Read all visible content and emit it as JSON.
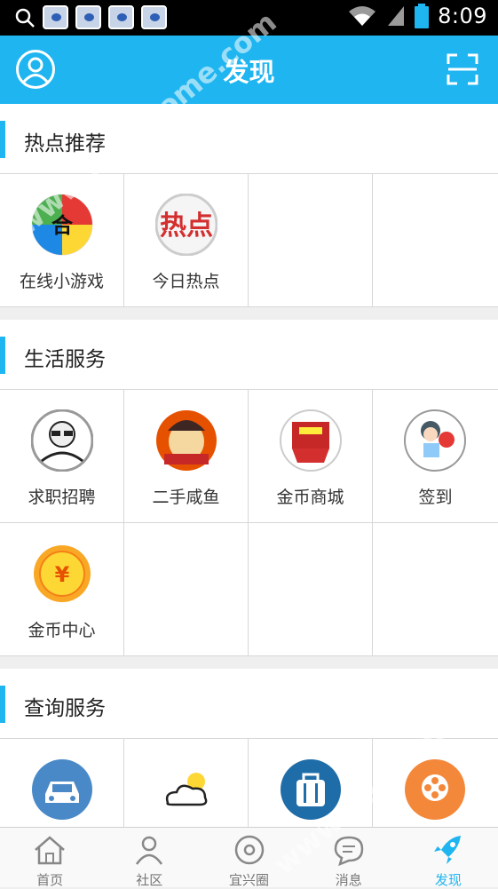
{
  "status_bar": {
    "time": "8:09"
  },
  "header": {
    "title": "发现",
    "profile_icon": "profile-icon",
    "scan_icon": "scan-icon"
  },
  "sections": [
    {
      "title": "热点推荐",
      "items": [
        {
          "label": "在线小游戏",
          "icon": "mini-games-icon"
        },
        {
          "label": "今日热点",
          "icon": "hot-topics-icon"
        }
      ]
    },
    {
      "title": "生活服务",
      "items": [
        {
          "label": "求职招聘",
          "icon": "jobs-icon"
        },
        {
          "label": "二手咸鱼",
          "icon": "second-hand-icon"
        },
        {
          "label": "金币商城",
          "icon": "coin-mall-icon"
        },
        {
          "label": "签到",
          "icon": "check-in-icon"
        },
        {
          "label": "金币中心",
          "icon": "coin-center-icon"
        }
      ]
    },
    {
      "title": "查询服务",
      "items": [
        {
          "label": "",
          "icon": "car-icon"
        },
        {
          "label": "",
          "icon": "weather-icon"
        },
        {
          "label": "",
          "icon": "bag-icon"
        },
        {
          "label": "",
          "icon": "film-icon"
        }
      ]
    }
  ],
  "tabs": [
    {
      "label": "首页",
      "icon": "home-icon"
    },
    {
      "label": "社区",
      "icon": "community-icon"
    },
    {
      "label": "宜兴圈",
      "icon": "circle-icon"
    },
    {
      "label": "消息",
      "icon": "message-icon"
    },
    {
      "label": "发现",
      "icon": "rocket-icon",
      "active": true
    }
  ],
  "watermark": "www.hackhome.com",
  "colors": {
    "accent": "#1fb5f0",
    "background": "#efefef"
  }
}
